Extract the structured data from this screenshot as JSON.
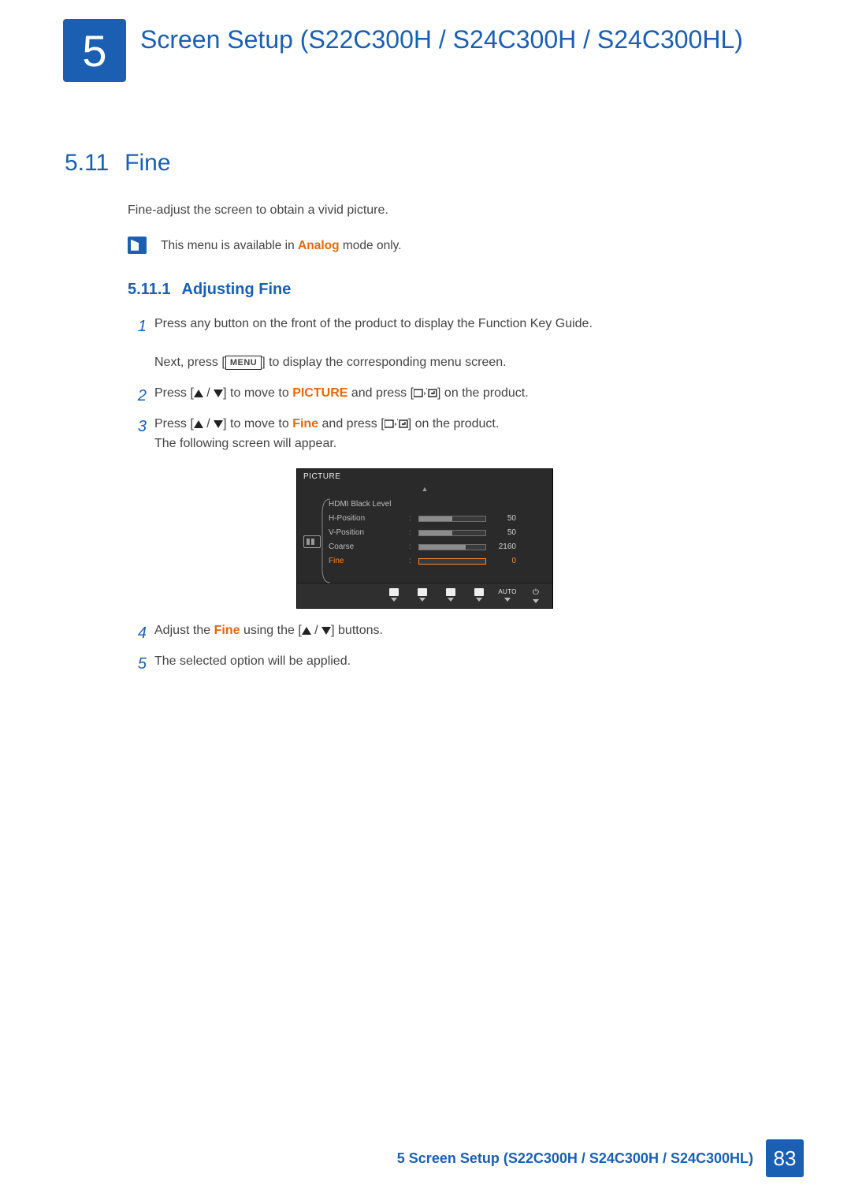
{
  "chapter": {
    "number": "5",
    "title": "Screen Setup (S22C300H / S24C300H / S24C300HL)"
  },
  "section": {
    "number": "5.11",
    "title": "Fine"
  },
  "intro": "Fine-adjust the screen to obtain a vivid picture.",
  "note": {
    "prefix": "This menu is available in ",
    "emph": "Analog",
    "suffix": " mode only."
  },
  "subsection": {
    "number": "5.11.1",
    "title": "Adjusting Fine"
  },
  "steps": {
    "s1": {
      "line1": "Press any button on the front of the product to display the Function Key Guide.",
      "line2a": "Next, press [",
      "menu": "MENU",
      "line2b": "] to display the corresponding menu screen."
    },
    "s2": {
      "a": "Press [",
      "b": "] to move to ",
      "kw": "PICTURE",
      "c": " and press [",
      "d": "] on the product."
    },
    "s3": {
      "a": "Press [",
      "b": "] to move to ",
      "kw": "Fine",
      "c": " and press [",
      "d": "] on the product.",
      "e": "The following screen will appear."
    },
    "s4": {
      "a": "Adjust the ",
      "kw": "Fine",
      "b": " using the [",
      "c": "] buttons."
    },
    "s5": "The selected option will be applied."
  },
  "osd": {
    "title": "PICTURE",
    "rows": [
      {
        "label": "HDMI Black Level",
        "value": "",
        "bar": null
      },
      {
        "label": "H-Position",
        "value": "50",
        "bar": 50
      },
      {
        "label": "V-Position",
        "value": "50",
        "bar": 50
      },
      {
        "label": "Coarse",
        "value": "2160",
        "bar": 70
      },
      {
        "label": "Fine",
        "value": "0",
        "bar": 0,
        "selected": true
      }
    ],
    "footer_auto": "AUTO"
  },
  "footer": {
    "text": "5 Screen Setup (S22C300H / S24C300H / S24C300HL)",
    "page": "83"
  }
}
